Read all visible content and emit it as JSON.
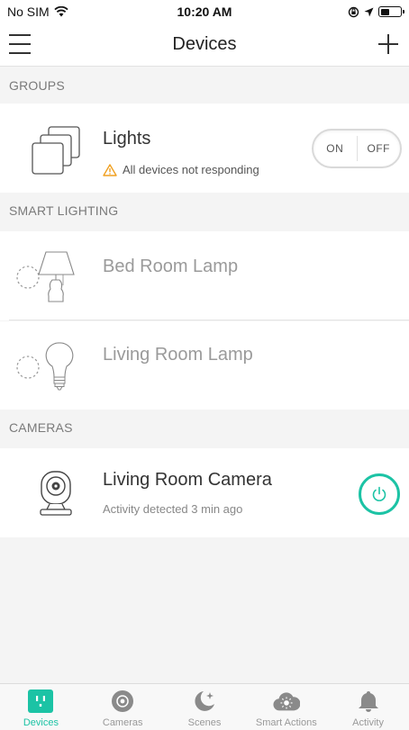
{
  "status_bar": {
    "carrier": "No SIM",
    "time": "10:20 AM"
  },
  "nav": {
    "title": "Devices",
    "menu_icon": "hamburger-icon",
    "add_icon": "plus-icon"
  },
  "sections": {
    "groups": "GROUPS",
    "smart_lighting": "SMART LIGHTING",
    "cameras": "CAMERAS"
  },
  "groups": [
    {
      "name": "Lights",
      "warning": "All devices not responding",
      "toggle_on": "ON",
      "toggle_off": "OFF"
    }
  ],
  "lighting": [
    {
      "name": "Bed Room Lamp",
      "icon": "lamp-icon"
    },
    {
      "name": "Living Room Lamp",
      "icon": "bulb-icon"
    }
  ],
  "cameras": [
    {
      "name": "Living Room Camera",
      "activity": "Activity detected 3 min ago"
    }
  ],
  "tabs": [
    {
      "label": "Devices",
      "icon": "plug-icon",
      "active": true
    },
    {
      "label": "Cameras",
      "icon": "camera-lens-icon",
      "active": false
    },
    {
      "label": "Scenes",
      "icon": "moon-icon",
      "active": false
    },
    {
      "label": "Smart Actions",
      "icon": "cloud-sun-icon",
      "active": false
    },
    {
      "label": "Activity",
      "icon": "bell-icon",
      "active": false
    }
  ],
  "colors": {
    "accent": "#1cc3a5",
    "warning": "#f0a020",
    "section_bg": "#f4f4f4"
  }
}
